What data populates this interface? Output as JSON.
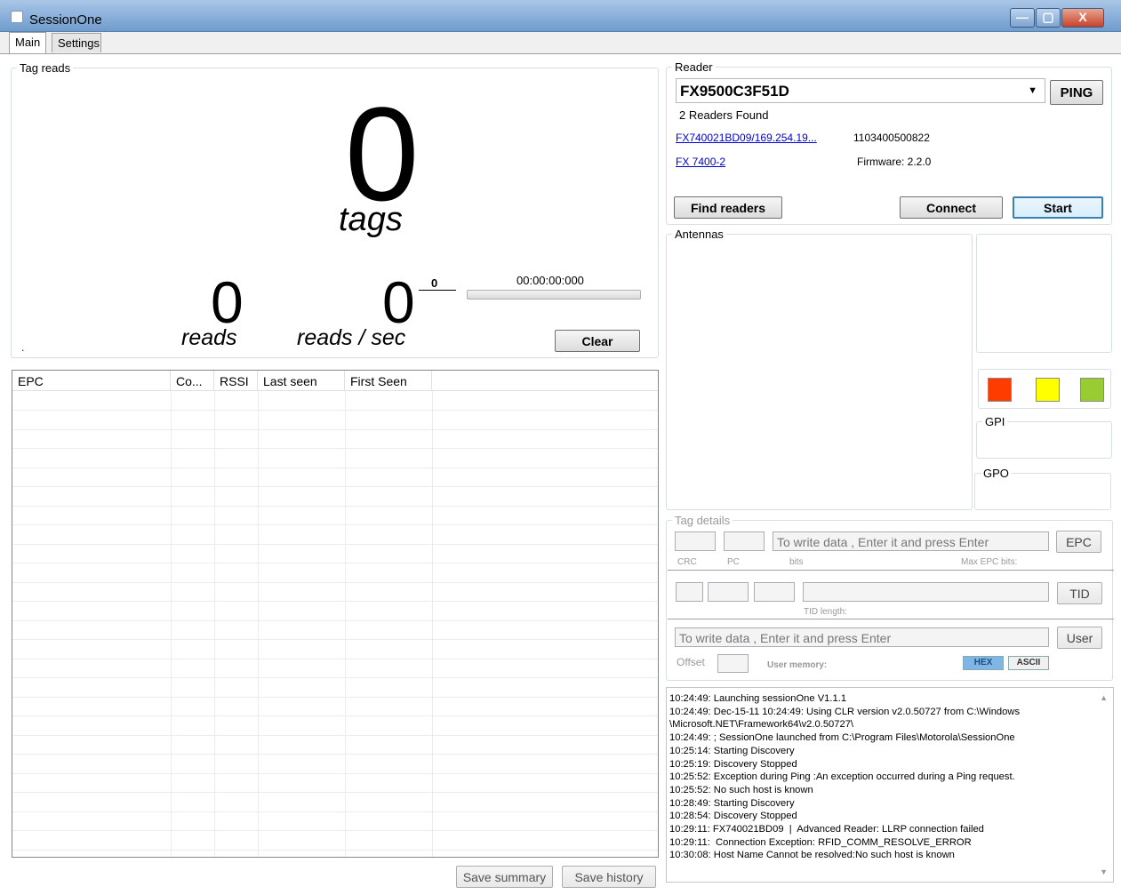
{
  "window": {
    "title": "SessionOne",
    "min": "—",
    "max": "▢",
    "close": "X"
  },
  "tabs": [
    {
      "label": "Main"
    },
    {
      "label": "Settings"
    }
  ],
  "tag_reads": {
    "group_label": "Tag reads",
    "tags_count": "0",
    "tags_label": "tags",
    "reads_count": "0",
    "reads_label": "reads",
    "rate_count": "0",
    "rate_label": "reads / sec",
    "rate_superscript": "0",
    "timer": "00:00:00:000",
    "clear_label": "Clear",
    "corner_dot": "."
  },
  "grid": {
    "columns": [
      "EPC",
      "Co...",
      "RSSI",
      "Last seen",
      "First Seen"
    ]
  },
  "bottom_buttons": {
    "save_summary": "Save summary",
    "save_history": "Save history"
  },
  "reader": {
    "group_label": "Reader",
    "selected": "FX9500C3F51D",
    "dropdown_arrow": "▼",
    "ping_label": "PING",
    "found_text": "2 Readers Found",
    "found_readers": [
      {
        "link": "FX740021BD09/169.254.19...",
        "info": "1103400500822"
      },
      {
        "link": "FX 7400-2",
        "info": "Firmware: 2.2.0"
      }
    ],
    "find_label": "Find readers",
    "connect_label": "Connect",
    "start_label": "Start"
  },
  "antennas": {
    "group_label": "Antennas"
  },
  "io": {
    "leds": [
      "#ff3c00",
      "#ffff00",
      "#99cc33"
    ],
    "gpi_label": "GPI",
    "gpo_label": "GPO"
  },
  "tag_details": {
    "group_label": "Tag details",
    "epc_placeholder": "To write data , Enter it and press Enter",
    "epc_button": "EPC",
    "crc_label": "CRC",
    "pc_label": "PC",
    "bits_label": "bits",
    "max_epc_label": "Max EPC bits:",
    "tid_button": "TID",
    "tid_length_label": "TID length:",
    "user_placeholder": "To write data , Enter it and press Enter",
    "user_button": "User",
    "offset_label": "Offset",
    "user_memory_label": "User memory:",
    "hex_label": "HEX",
    "ascii_label": "ASCII"
  },
  "log": {
    "lines": [
      "10:24:49: Launching sessionOne V1.1.1",
      "10:24:49: Dec-15-11 10:24:49: Using CLR version v2.0.50727 from C:\\Windows",
      "\\Microsoft.NET\\Framework64\\v2.0.50727\\",
      "10:24:49: ; SessionOne launched from C:\\Program Files\\Motorola\\SessionOne",
      "10:25:14: Starting Discovery",
      "10:25:19: Discovery Stopped",
      "10:25:52: Exception during Ping :An exception occurred during a Ping request.",
      "10:25:52: No such host is known",
      "10:28:49: Starting Discovery",
      "10:28:54: Discovery Stopped",
      "10:29:11: FX740021BD09  |  Advanced Reader: LLRP connection failed",
      "10:29:11:  Connection Exception: RFID_COMM_RESOLVE_ERROR",
      "10:30:08: Host Name Cannot be resolved:No such host is known"
    ],
    "scroll_up": "▲",
    "scroll_down": "▼"
  }
}
